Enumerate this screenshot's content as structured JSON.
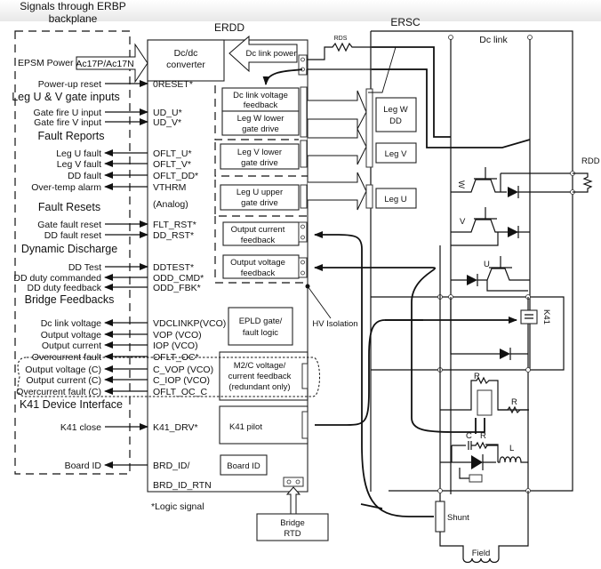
{
  "header": {
    "backplane_title_line1": "Signals through ERBP",
    "backplane_title_line2": "backplane",
    "erdd_title": "ERDD",
    "ersc_title": "ERSC"
  },
  "backplane": {
    "epsm_power": "EPSM Power",
    "epsm_connector": "Ac17P/Ac17N",
    "sections": {
      "gate_inputs": "Leg U & V gate inputs",
      "fault_reports": "Fault Reports",
      "fault_resets": "Fault Resets",
      "dynamic_discharge": "Dynamic Discharge",
      "bridge_feedbacks": "Bridge Feedbacks",
      "k41_interface": "K41 Device Interface"
    },
    "signals": [
      {
        "label": "Power-up reset",
        "pin": "0RESET*",
        "direction": "in"
      },
      {
        "label": "Gate fire U input",
        "pin": "UD_U*",
        "direction": "in"
      },
      {
        "label": "Gate fire V input",
        "pin": "UD_V*",
        "direction": "in"
      },
      {
        "label": "Leg U fault",
        "pin": "OFLT_U*",
        "direction": "out"
      },
      {
        "label": "Leg V fault",
        "pin": "OFLT_V*",
        "direction": "out"
      },
      {
        "label": "DD fault",
        "pin": "OFLT_DD*",
        "direction": "out"
      },
      {
        "label": "Over-temp alarm",
        "pin": "VTHRM",
        "direction": "out"
      },
      {
        "label": "Gate fault reset",
        "pin": "FLT_RST*",
        "direction": "in"
      },
      {
        "label": "DD fault reset",
        "pin": "DD_RST*",
        "direction": "in"
      },
      {
        "label": "DD Test",
        "pin": "DDTEST*",
        "direction": "in"
      },
      {
        "label": "DD duty commanded",
        "pin": "ODD_CMD*",
        "direction": "out"
      },
      {
        "label": "DD duty feedback",
        "pin": "ODD_FBK*",
        "direction": "out"
      },
      {
        "label": "Dc link voltage",
        "pin": "VDCLINKP(VCO)",
        "direction": "out"
      },
      {
        "label": "Output voltage",
        "pin": "VOP (VCO)",
        "direction": "out"
      },
      {
        "label": "Output current",
        "pin": "IOP (VCO)",
        "direction": "out"
      },
      {
        "label": "Overcurrent fault",
        "pin": "OFLT_OC*",
        "direction": "out"
      },
      {
        "label": "Output voltage (C)",
        "pin": "C_VOP (VCO)",
        "direction": "out"
      },
      {
        "label": "Output current  (C)",
        "pin": "C_IOP (VCO)",
        "direction": "out"
      },
      {
        "label": "Overcurrent fault (C)",
        "pin": "OFLT_OC_C",
        "direction": "out"
      },
      {
        "label": "K41 close",
        "pin": "K41_DRV*",
        "direction": "in"
      },
      {
        "label": "Board ID",
        "pin": "BRD_ID/",
        "direction": "out"
      }
    ],
    "vthrm_note": "(Analog)",
    "brd_id_rtn": "BRD_ID_RTN"
  },
  "erdd": {
    "dcdc_line1": "Dc/dc",
    "dcdc_line2": "converter",
    "dc_link_power": "Dc link power",
    "blocks": {
      "dclink_fb_1": "Dc link voltage",
      "dclink_fb_2": "feedback",
      "legw_1": "Leg W lower",
      "legw_2": "gate drive",
      "legv_1": "Leg V lower",
      "legv_2": "gate drive",
      "legu_1": "Leg U upper",
      "legu_2": "gate drive",
      "iout_1": "Output current",
      "iout_2": "feedback",
      "vout_1": "Output voltage",
      "vout_2": "feedback",
      "epld_1": "EPLD gate/",
      "epld_2": "fault logic",
      "m2c_1": "M2/C voltage/",
      "m2c_2": "current feedback",
      "m2c_3": "(redundant only)",
      "k41_pilot": "K41 pilot",
      "board_id": "Board ID"
    },
    "hv_isolation": "HV Isolation",
    "logic_note": "*Logic signal",
    "bridge_rtd_1": "Bridge",
    "bridge_rtd_2": "RTD"
  },
  "ersc": {
    "rds": "RDS",
    "dc_link": "Dc link",
    "leg_w_dd_1": "Leg W",
    "leg_w_dd_2": "DD",
    "leg_v": "Leg V",
    "leg_u": "Leg U",
    "rdd": "RDD",
    "igbt_w": "W",
    "igbt_v": "V",
    "igbt_u": "U",
    "k41": "K41",
    "r1": "R",
    "r2": "R",
    "r3": "R",
    "c": "C",
    "l": "L",
    "shunt": "Shunt",
    "field": "Field"
  }
}
